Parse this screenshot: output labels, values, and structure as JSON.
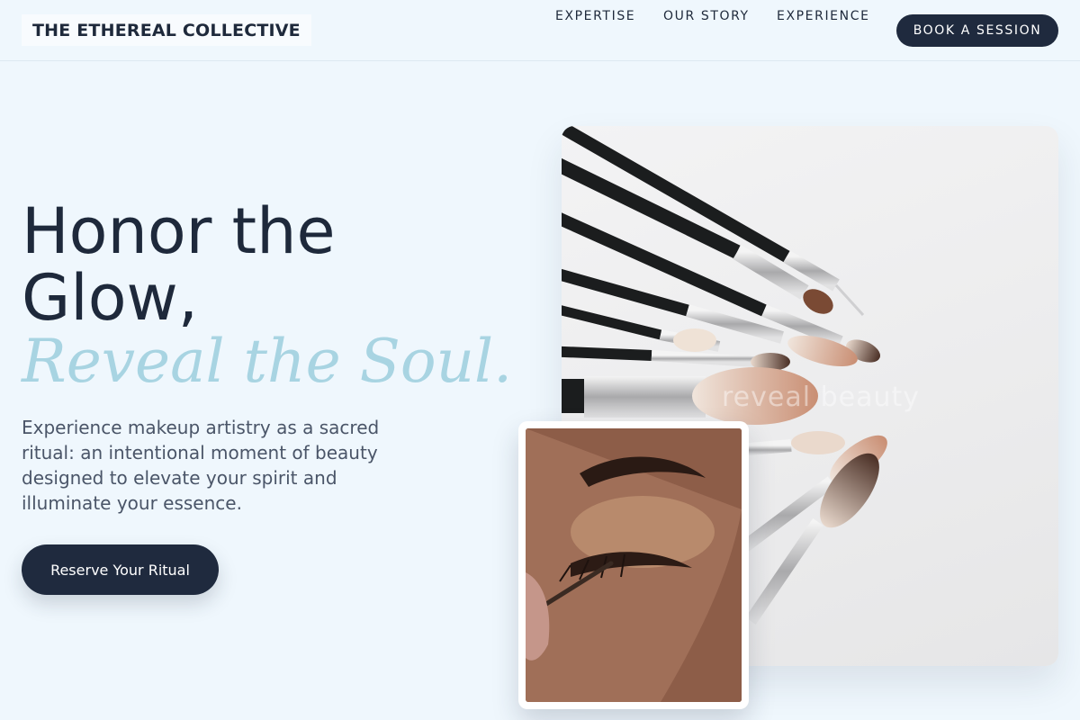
{
  "header": {
    "logo": "THE ETHEREAL COLLECTIVE",
    "nav": [
      {
        "label": "EXPERTISE"
      },
      {
        "label": "OUR STORY"
      },
      {
        "label": "EXPERIENCE"
      }
    ],
    "book_button": "BOOK A SESSION"
  },
  "hero": {
    "title_line1": "Honor the",
    "title_line2": "Glow,",
    "title_accent": "Reveal the Soul.",
    "description": "Experience makeup artistry as a sacred ritual: an intentional moment of beauty designed to elevate your spirit and illuminate your essence.",
    "cta": "Reserve Your Ritual"
  },
  "images": {
    "main_watermark": "reveal beauty",
    "main_icon": "makeup-brushes-photo",
    "inset_icon": "eye-makeup-photo"
  },
  "colors": {
    "background": "#eff7fd",
    "navy": "#1f2a3e",
    "accent": "#a8d4e2",
    "body_text": "#4a5568"
  }
}
